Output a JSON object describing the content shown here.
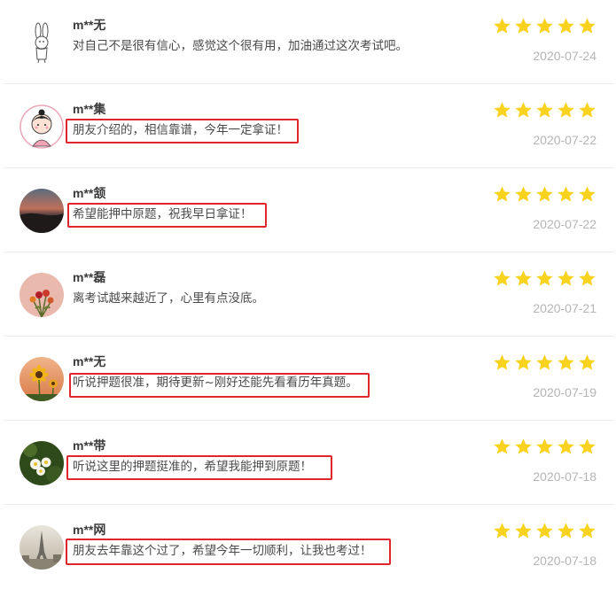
{
  "reviews": [
    {
      "name": "m**无",
      "comment": "对自己不是很有信心，感觉这个很有用，加油通过这次考试吧。",
      "rating": 5,
      "date": "2020-07-24",
      "highlighted": false,
      "avatar": "rabbit-avatar"
    },
    {
      "name": "m**集",
      "comment": "朋友介绍的，相信靠谱，今年一定拿证！",
      "rating": 5,
      "date": "2020-07-22",
      "highlighted": true,
      "avatar": "girl-avatar"
    },
    {
      "name": "m**颔",
      "comment": "希望能押中原题，祝我早日拿证！",
      "rating": 5,
      "date": "2020-07-22",
      "highlighted": true,
      "avatar": "sunset-avatar"
    },
    {
      "name": "m**磊",
      "comment": "离考试越来越近了，心里有点没底。",
      "rating": 5,
      "date": "2020-07-21",
      "highlighted": false,
      "avatar": "flowers-avatar"
    },
    {
      "name": "m**无",
      "comment": "听说押题很准，期待更新~刚好还能先看看历年真题。",
      "rating": 5,
      "date": "2020-07-19",
      "highlighted": true,
      "avatar": "sunflower-avatar"
    },
    {
      "name": "m**带",
      "comment": "听说这里的押题挺准的，希望我能押到原题！",
      "rating": 5,
      "date": "2020-07-18",
      "highlighted": true,
      "avatar": "daisy-avatar"
    },
    {
      "name": "m**网",
      "comment": "朋友去年靠这个过了，希望今年一切顺利，让我也考过！",
      "rating": 5,
      "date": "2020-07-18",
      "highlighted": true,
      "avatar": "eiffel-avatar"
    }
  ],
  "colors": {
    "star": "#f8d21d",
    "highlight_border": "#e0262c",
    "date": "#b5b5b5"
  }
}
